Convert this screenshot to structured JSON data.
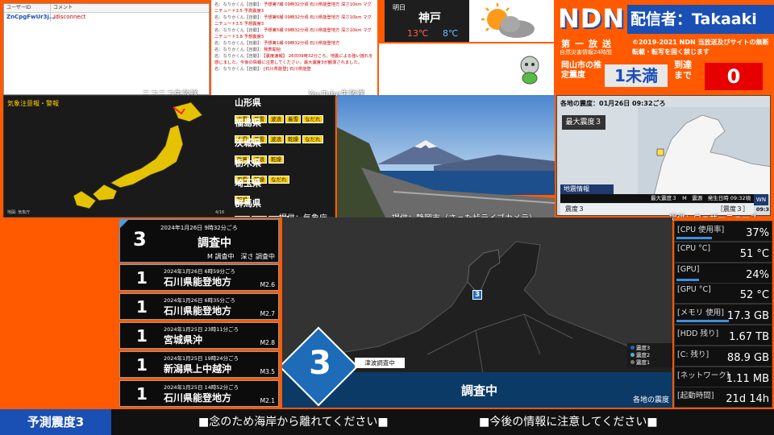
{
  "comment_box": {
    "col_user": "ユーザーID",
    "col_comment": "コメント",
    "rows": [
      {
        "user": "ZnCpgFwUr3j...",
        "comment": "/disconnect"
      }
    ]
  },
  "youtube_log": [
    {
      "user": "名：なりかくん【自動】",
      "text": "予想第7報 09時32分頃 石川県能登地方 深さ10km マグニチュード3.5 予測震度3"
    },
    {
      "user": "名：なりかくん【自動】",
      "text": "予想第6報 09時32分頃 石川県能登地方 深さ10km マグニチュード3.5 予想震度3"
    },
    {
      "user": "名：なりかくん【自動】",
      "text": "予想第5報 09時32分頃 石川県能登地方 深さ10km マグニチュード3.8 予想震度3"
    },
    {
      "user": "名：なりかくん【自動】",
      "text": "予想第1報 09時32分頃 石川県能登地方"
    },
    {
      "user": "名：なりかくん【自動】",
      "text": "発表開始"
    },
    {
      "user": "名：なりかくん【自動】",
      "text": "【震度速報】 26日09時32分ころ、地震による強い揺れを感じました。今後の情報に注意してください。最大震度3が観測されました。"
    },
    {
      "user": "名：なりかくん【自動】",
      "text": "[石川県能登] 石川県能登"
    }
  ],
  "weather": {
    "day": "明日",
    "city": "神戸",
    "high": "13℃",
    "low": "8℃"
  },
  "ndn": {
    "logo": "NDN",
    "streamer_prefix": "配信者：",
    "streamer": "Takaaki",
    "broadcast_label": "第一放送",
    "sub_label": "自然災害情報24時間",
    "copyright": "©2019-2021 NDN 当放送及びサイトの無断転載・転写を固く禁じます",
    "city_label": "岡山市の推定震度",
    "city_intensity": "1未満",
    "arrival_label": "到達まで",
    "arrival_value": "0"
  },
  "source_labels": {
    "niconico": "ニコニコ生放送",
    "youtube": "YouTube生放送",
    "jma": "提供：気象庁",
    "shizuoka": "提供：静岡市（さった峠ライブカメラ）",
    "weathernews": "提供：ウェザーニュース"
  },
  "warning_map": {
    "title": "気象注意報・警報",
    "footer_left": "地図: 気象庁",
    "footer_right": "4/16",
    "prefectures": [
      {
        "name": "山形県",
        "badges": [
          "大雪",
          "風雪",
          "波浪",
          "着雪",
          "なだれ"
        ]
      },
      {
        "name": "福島県",
        "badges": [
          "大雪",
          "風雪",
          "波浪",
          "乾燥",
          "なだれ"
        ]
      },
      {
        "name": "茨城県",
        "badges": [
          "強風",
          "波浪",
          "乾燥"
        ]
      },
      {
        "name": "栃木県",
        "badges": [
          "風雪",
          "乾燥",
          "なだれ"
        ]
      },
      {
        "name": "埼玉県",
        "badges": [
          "乾燥"
        ]
      },
      {
        "name": "群馬県",
        "badges": [
          "大雪",
          "着雪",
          "なだれ"
        ]
      }
    ]
  },
  "wn_panel": {
    "header": "各地の震度：01月26日 09:32ごろ",
    "max_label": "最大震度３",
    "info_title": "地震情報",
    "info_line": "最大震度３　M　震源　発生日時 09:32頃",
    "bottom_left": "震度３",
    "bottom_right": "［震度３］",
    "logo": "WN",
    "time": "09:3"
  },
  "quake_list": {
    "current": {
      "intensity": "3",
      "time": "2024年1月26日 9時32分ごろ",
      "place": "調査中",
      "detail": "M 調査中　深さ 調査中"
    },
    "items": [
      {
        "intensity": "1",
        "time": "2024年1月26日 6時59分ごろ",
        "place": "石川県能登地方",
        "mag": "M2.6"
      },
      {
        "intensity": "1",
        "time": "2024年1月26日 6時35分ごろ",
        "place": "石川県能登地方",
        "mag": "M2.7"
      },
      {
        "intensity": "1",
        "time": "2024年1月25日 23時11分ごろ",
        "place": "宮城県沖",
        "mag": "M2.8"
      },
      {
        "intensity": "1",
        "time": "2024年1月25日 19時24分ごろ",
        "place": "新潟県上中越沖",
        "mag": "M3.5"
      },
      {
        "intensity": "1",
        "time": "2024年1月25日 14時52分ごろ",
        "place": "石川県能登地方",
        "mag": "M2.1"
      }
    ]
  },
  "eq_map": {
    "intensity": "3",
    "tsunami": "津波調査中",
    "status": "調査中",
    "caption": "各地の震度",
    "marker": "3",
    "legend": [
      "震度3",
      "震度2",
      "震度1"
    ]
  },
  "sysmon": [
    {
      "label": "[CPU 使用率]",
      "value": "37%",
      "bar": 0.37
    },
    {
      "label": "[CPU °C]",
      "value": "51 °C",
      "bar": 0.0
    },
    {
      "label": "[GPU]",
      "value": "24%",
      "bar": 0.24
    },
    {
      "label": "[GPU °C]",
      "value": "52 °C",
      "bar": 0.0
    },
    {
      "label": "[メモリ 使用]",
      "value": "17.3 GB",
      "bar": 0.55
    },
    {
      "label": "[HDD 残り]",
      "value": "1.67 TB",
      "bar": 0.0
    },
    {
      "label": "[C: 残り]",
      "value": "88.9 GB",
      "bar": 0.0
    },
    {
      "label": "[ネットワーク]",
      "value": "1.11 MB",
      "bar": 0.0
    },
    {
      "label": "[起動時間]",
      "value": "21d 14h",
      "bar": 0.0
    }
  ],
  "ticker": {
    "left": "予測震度3",
    "msg1": "■念のため海岸から離れてください■",
    "msg2": "■今後の情報に注意してください■"
  },
  "colors": {
    "orange": "#ff5a00",
    "blue": "#1a4fb4",
    "accent_blue": "#1e6bb8",
    "alert_red": "#e60000"
  }
}
